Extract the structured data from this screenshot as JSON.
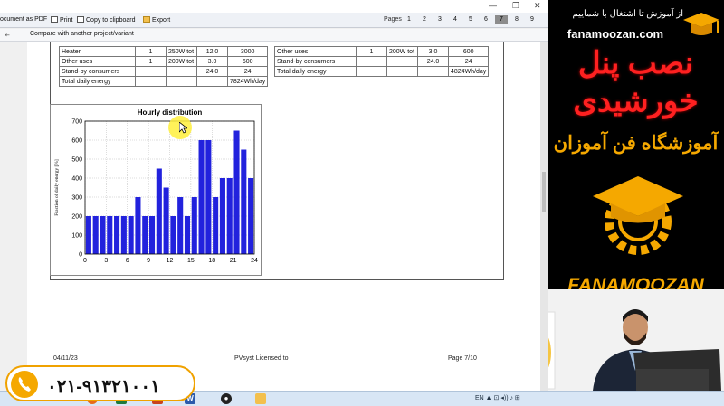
{
  "toolbar": {
    "doc_label": "ocument as PDF",
    "print_label": "Print",
    "copy_label": "Copy to clipboard",
    "export_label": "Export",
    "pages_label": "Pages",
    "pages": [
      "1",
      "2",
      "3",
      "4",
      "5",
      "6",
      "7",
      "8",
      "9"
    ],
    "active_page": "7",
    "compare_label": "Compare with another project/variant"
  },
  "left_table": {
    "rows": [
      [
        "Heater",
        "1",
        "250W tot",
        "12.0",
        "3000"
      ],
      [
        "Other uses",
        "1",
        "200W tot",
        "3.0",
        "600"
      ],
      [
        "Stand-by consumers",
        "",
        "",
        "24.0",
        "24"
      ],
      [
        "Total daily energy",
        "",
        "",
        "",
        "7824Wh/day"
      ]
    ]
  },
  "right_table": {
    "rows": [
      [
        "Other uses",
        "1",
        "200W tot",
        "3.0",
        "600"
      ],
      [
        "Stand-by consumers",
        "",
        "",
        "24.0",
        "24"
      ],
      [
        "Total daily energy",
        "",
        "",
        "",
        "4824Wh/day"
      ]
    ]
  },
  "chart_data": {
    "type": "bar",
    "title": "Hourly distribution",
    "ylabel": "Fraction of daily energy [%]",
    "xlabel": "",
    "x": [
      0.5,
      1.5,
      2.5,
      3.5,
      4.5,
      5.5,
      6.5,
      7.5,
      8.5,
      9.5,
      10.5,
      11.5,
      12.5,
      13.5,
      14.5,
      15.5,
      16.5,
      17.5,
      18.5,
      19.5,
      20.5,
      21.5,
      22.5,
      23.5
    ],
    "values": [
      200,
      200,
      200,
      200,
      200,
      200,
      200,
      300,
      200,
      200,
      450,
      350,
      200,
      300,
      200,
      300,
      600,
      600,
      300,
      400,
      400,
      650,
      550,
      400
    ],
    "xlim": [
      0,
      24
    ],
    "ylim": [
      0,
      700
    ],
    "xticks": [
      "0",
      "3",
      "6",
      "9",
      "12",
      "15",
      "18",
      "21",
      "24"
    ],
    "yticks": [
      "0",
      "100",
      "200",
      "300",
      "400",
      "500",
      "600",
      "700"
    ],
    "grid": true,
    "bar_color": "#2222dd"
  },
  "footer": {
    "date": "04/11/23",
    "license": "PVsyst Licensed to",
    "page": "Page 7/10"
  },
  "taskbar": {
    "tray_text": "EN  ▲  ⊡  ◂))  ♪  ⊞"
  },
  "phone": {
    "number": "۰۲۱-۹۱۳۲۱۰۰۱"
  },
  "brand": {
    "tagline": "از آموزش تا اشتغال با شماییم",
    "site": "fanamoozan.com",
    "title_line1": "نصب پنل",
    "title_line2": "خورشیدی",
    "academy": "آموزشگاه فن آموزان",
    "name": "FANAMOOZAN",
    "accent": "#f5a800",
    "title_color": "#ff2020"
  }
}
